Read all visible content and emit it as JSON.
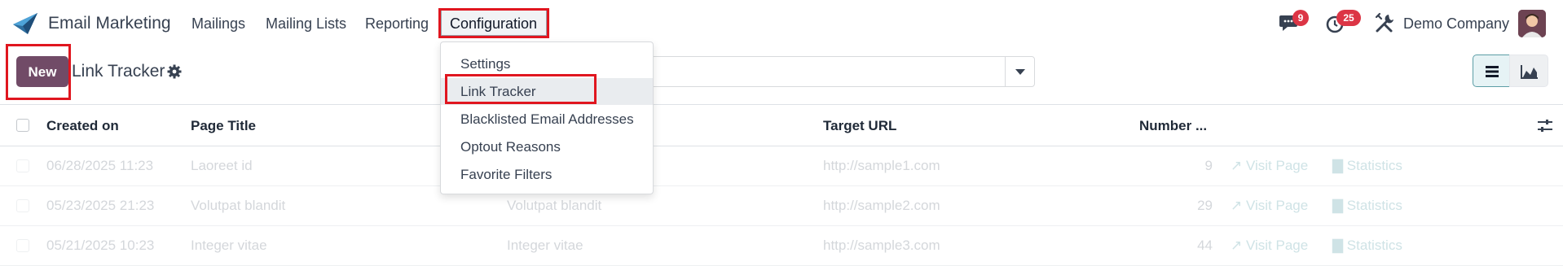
{
  "app": {
    "name": "Email Marketing"
  },
  "nav": {
    "items": [
      {
        "label": "Mailings"
      },
      {
        "label": "Mailing Lists"
      },
      {
        "label": "Reporting"
      },
      {
        "label": "Configuration"
      }
    ]
  },
  "systray": {
    "messages_count": "9",
    "activities_count": "25",
    "company": "Demo Company"
  },
  "control": {
    "new_label": "New",
    "title": "Link Tracker"
  },
  "dropdown": {
    "items": [
      {
        "label": "Settings"
      },
      {
        "label": "Link Tracker"
      },
      {
        "label": "Blacklisted Email Addresses"
      },
      {
        "label": "Optout Reasons"
      },
      {
        "label": "Favorite Filters"
      }
    ]
  },
  "table": {
    "columns": [
      "Created on",
      "Page Title",
      "Target URL",
      "Number ..."
    ],
    "rows": [
      {
        "created": "06/28/2025 11:23",
        "title": "Laoreet id",
        "title2": "",
        "url": "http://sample1.com",
        "number": "9",
        "visit": "Visit Page",
        "stats": "Statistics"
      },
      {
        "created": "05/23/2025 21:23",
        "title": "Volutpat blandit",
        "title2": "Volutpat blandit",
        "url": "http://sample2.com",
        "number": "29",
        "visit": "Visit Page",
        "stats": "Statistics"
      },
      {
        "created": "05/21/2025 10:23",
        "title": "Integer vitae",
        "title2": "Integer vitae",
        "url": "http://sample3.com",
        "number": "44",
        "visit": "Visit Page",
        "stats": "Statistics"
      }
    ]
  },
  "colors": {
    "brand": "#714b67",
    "annotation": "#e0161f",
    "badge": "#dc3545",
    "active_view": "#e6f3f5"
  }
}
